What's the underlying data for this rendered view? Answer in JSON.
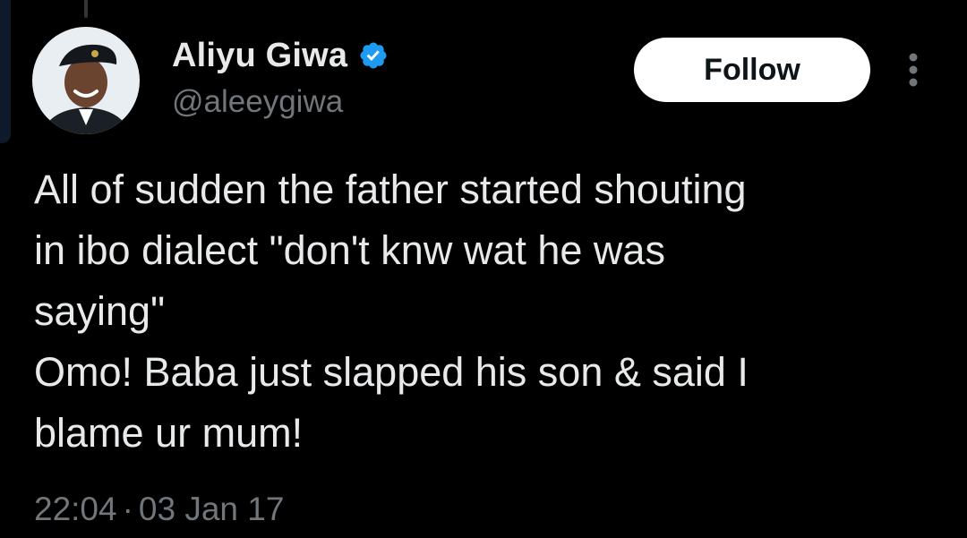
{
  "author": {
    "display_name": "Aliyu Giwa",
    "handle": "@aleeygiwa",
    "verified": true
  },
  "actions": {
    "follow_label": "Follow",
    "more_icon": "more-vertical-icon"
  },
  "tweet": {
    "lines": [
      "All of sudden the father started shouting",
      "in ibo dialect \"don't knw wat he was",
      "saying\"",
      "Omo! Baba just slapped his son & said I",
      "blame ur mum!"
    ],
    "time": "22:04",
    "separator": "·",
    "date": "03 Jan 17"
  },
  "colors": {
    "background": "#000000",
    "primary_text": "#e7e9ea",
    "secondary_text": "#71767b",
    "verified_badge": "#1d9bf0",
    "follow_button_bg": "#ffffff"
  }
}
